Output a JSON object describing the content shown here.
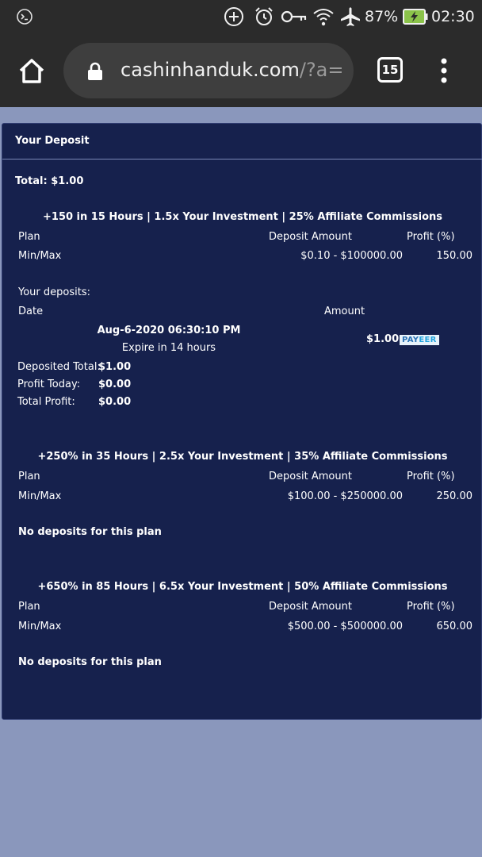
{
  "status_bar": {
    "battery": "87%",
    "time": "02:30",
    "icons": [
      "terminal-icon",
      "add-circle-icon",
      "alarm-icon",
      "key-icon",
      "wifi-icon",
      "airplane-icon",
      "battery-charging-icon"
    ]
  },
  "browser": {
    "url_main": "cashinhanduk.com",
    "url_rest": "/?a=",
    "tab_count": "15"
  },
  "panel": {
    "title": "Your Deposit",
    "total": "Total: $1.00"
  },
  "headers": {
    "plan": "Plan",
    "deposit_amount": "Deposit Amount",
    "profit": "Profit (%)",
    "minmax": "Min/Max"
  },
  "plans": [
    {
      "name": "+150 in 15 Hours | 1.5x Your Investment | 25% Affiliate Commissions",
      "range": "$0.10 - $100000.00",
      "profit": "150.00"
    },
    {
      "name": "+250% in 35 Hours | 2.5x Your Investment | 35% Affiliate Commissions",
      "range": "$100.00 - $250000.00",
      "profit": "250.00",
      "no_deposits": "No deposits for this plan"
    },
    {
      "name": "+650% in 85 Hours | 6.5x Your Investment | 50% Affiliate Commissions",
      "range": "$500.00 - $500000.00",
      "profit": "650.00",
      "no_deposits": "No deposits for this plan"
    }
  ],
  "deposits": {
    "label": "Your deposits:",
    "date_header": "Date",
    "amount_header": "Amount",
    "date": "Aug-6-2020 06:30:10 PM",
    "expire": "Expire in 14 hours",
    "amount": "$1.00",
    "processor_a": "PAY",
    "processor_b": "EER",
    "deposited_total_label": "Deposited Total:",
    "deposited_total": "$1.00",
    "profit_today_label": "Profit Today:",
    "profit_today": "$0.00",
    "total_profit_label": "Total Profit:",
    "total_profit": "$0.00"
  }
}
